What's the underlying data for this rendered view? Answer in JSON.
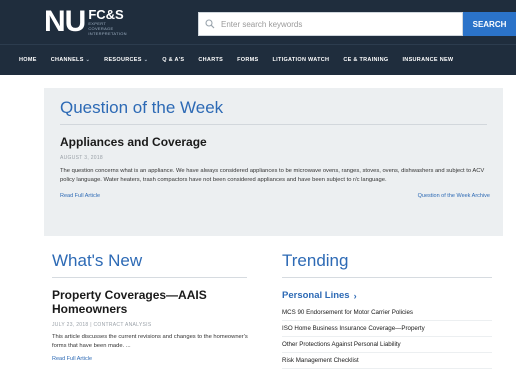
{
  "header": {
    "logo_main": "NU",
    "logo_fcs": "FC&S",
    "logo_tagline": "Expert Coverage Interpretation",
    "search_placeholder": "Enter search keywords",
    "search_button": "SEARCH"
  },
  "nav": {
    "items": [
      {
        "label": "HOME",
        "dropdown": false
      },
      {
        "label": "CHANNELS",
        "dropdown": true
      },
      {
        "label": "RESOURCES",
        "dropdown": true
      },
      {
        "label": "Q & A'S",
        "dropdown": false
      },
      {
        "label": "CHARTS",
        "dropdown": false
      },
      {
        "label": "FORMS",
        "dropdown": false
      },
      {
        "label": "LITIGATION WATCH",
        "dropdown": false
      },
      {
        "label": "CE & TRAINING",
        "dropdown": false
      },
      {
        "label": "INSURANCE NEW",
        "dropdown": false
      }
    ],
    "caret": "⌄"
  },
  "qotw": {
    "header": "Question of the Week",
    "title": "Appliances and Coverage",
    "date": "AUGUST 3, 2018",
    "body": "The question concerns what is an appliance. We have always considered appliances to be microwave ovens, ranges, stoves, ovens, dishwashers and subject to ACV policy language. Water heaters, trash compactors have not been considered appliances and have been subject to r/c language.",
    "read_link": "Read Full Article",
    "archive_link": "Question of the Week Archive"
  },
  "whats_new": {
    "header": "What's New",
    "title": "Property Coverages—AAIS Homeowners",
    "meta": "JULY 23, 2018  |  CONTRACT ANALYSIS",
    "body": "This article discusses the current revisions and changes to the homeowner's forms that have been made. ...",
    "read_link": "Read Full Article"
  },
  "trending": {
    "header": "Trending",
    "category": "Personal Lines",
    "category_chevron": "›",
    "items": [
      "MCS 90 Endorsement for Motor Carrier Policies",
      "ISO Home Business Insurance Coverage—Property",
      "Other Protections Against Personal Liability",
      "Risk Management Checklist"
    ]
  },
  "colors": {
    "header_bg": "#1f2d3d",
    "accent_blue": "#2d6ab5",
    "search_button_bg": "#2b73c9",
    "panel_bg": "#eceff1"
  }
}
